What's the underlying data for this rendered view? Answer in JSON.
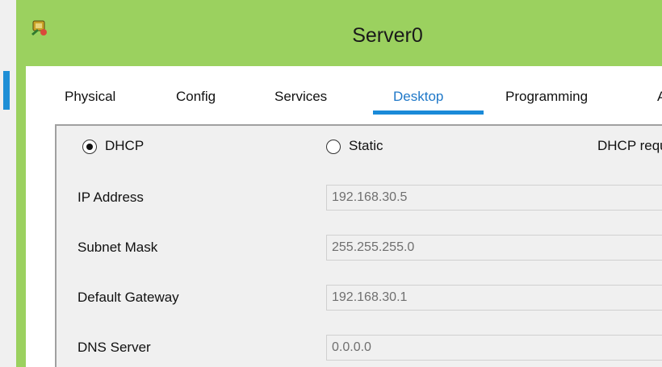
{
  "window": {
    "title": "Server0",
    "icon": "packet-tracer-server-icon"
  },
  "tabs": [
    {
      "label": "Physical"
    },
    {
      "label": "Config"
    },
    {
      "label": "Services"
    },
    {
      "label": "Desktop",
      "active": true
    },
    {
      "label": "Programming"
    },
    {
      "label": "A"
    }
  ],
  "ip_config": {
    "mode": {
      "dhcp_label": "DHCP",
      "dhcp_selected": true,
      "static_label": "Static",
      "static_selected": false,
      "status_text": "DHCP requ"
    },
    "fields": [
      {
        "label": "IP Address",
        "value": "192.168.30.5"
      },
      {
        "label": "Subnet Mask",
        "value": "255.255.255.0"
      },
      {
        "label": "Default Gateway",
        "value": "192.168.30.1"
      },
      {
        "label": "DNS Server",
        "value": "0.0.0.0"
      }
    ]
  },
  "colors": {
    "titlebar": "#9bd15f",
    "active_tab": "#1f78c8",
    "tab_underline": "#1a8ad8"
  }
}
